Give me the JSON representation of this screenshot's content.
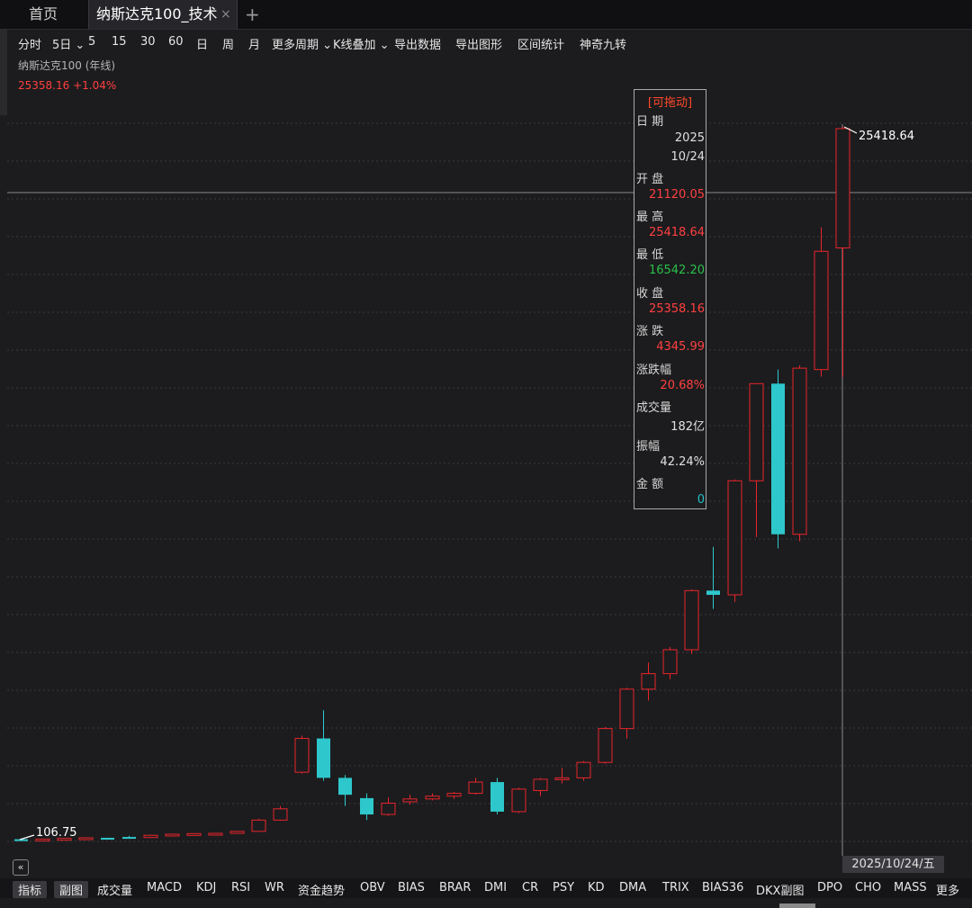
{
  "tabs": {
    "home": "首页",
    "active": "纳斯达克100_技术",
    "close": "×",
    "add": "+"
  },
  "toolbar": [
    "分时",
    "5日",
    "5",
    "15",
    "30",
    "60",
    "日",
    "周",
    "月",
    "更多周期",
    "K线叠加",
    "导出数据",
    "导出图形",
    "区间统计",
    "神奇九转"
  ],
  "chart_header": {
    "title": "纳斯达克100 (年线)",
    "price": "25358.16",
    "change": "+1.04%"
  },
  "colors": {
    "up": "#e8252b",
    "down": "#2ec8cc",
    "background": "#1c1c1e",
    "grid": "#3a3a3e"
  },
  "infobox": {
    "header": "[可拖动]",
    "date_label": "日 期",
    "date_year": "2025",
    "date_md": "10/24",
    "open_label": "开 盘",
    "open": "21120.05",
    "high_label": "最 高",
    "high": "25418.64",
    "low_label": "最 低",
    "low": "16542.20",
    "close_label": "收 盘",
    "close": "25358.16",
    "change_label": "涨 跌",
    "change": "4345.99",
    "pct_label": "涨跌幅",
    "pct": "20.68%",
    "volume_label": "成交量",
    "volume": "182亿",
    "amplitude_label": "振幅",
    "amplitude": "42.24%",
    "amount_label": "金 额",
    "amount": "0"
  },
  "annotations": {
    "max": "25418.64",
    "min": "106.75"
  },
  "cursor_date": "2025/10/24/五",
  "indicator_bar": {
    "index_btn": "指标",
    "sub_btn": "副图",
    "items": [
      "成交量",
      "MACD",
      "KDJ",
      "RSI",
      "WR",
      "资金趋势",
      "OBV",
      "BIAS",
      "BRAR",
      "DMI",
      "CR",
      "PSY",
      "KD",
      "DMA",
      "TRIX",
      "BIAS36",
      "DKX副图",
      "DPO",
      "CHO",
      "MASS",
      "更多"
    ]
  },
  "chart_data": {
    "type": "candlestick",
    "period": "yearly",
    "candles": [
      {
        "o": 120,
        "c": 110,
        "h": 130,
        "l": 106.75
      },
      {
        "o": 110,
        "c": 125,
        "h": 130,
        "l": 108
      },
      {
        "o": 125,
        "c": 150,
        "h": 160,
        "l": 120
      },
      {
        "o": 150,
        "c": 170,
        "h": 180,
        "l": 145
      },
      {
        "o": 170,
        "c": 165,
        "h": 175,
        "l": 160
      },
      {
        "o": 200,
        "c": 180,
        "h": 240,
        "l": 175
      },
      {
        "o": 180,
        "c": 260,
        "h": 270,
        "l": 175
      },
      {
        "o": 260,
        "c": 300,
        "h": 310,
        "l": 255
      },
      {
        "o": 300,
        "c": 320,
        "h": 330,
        "l": 295
      },
      {
        "o": 320,
        "c": 330,
        "h": 340,
        "l": 315
      },
      {
        "o": 330,
        "c": 400,
        "h": 420,
        "l": 325
      },
      {
        "o": 400,
        "c": 800,
        "h": 850,
        "l": 395
      },
      {
        "o": 800,
        "c": 1200,
        "h": 1300,
        "l": 780
      },
      {
        "o": 2500,
        "c": 3700,
        "h": 3800,
        "l": 2450
      },
      {
        "o": 3700,
        "c": 2300,
        "h": 4700,
        "l": 2200
      },
      {
        "o": 2300,
        "c": 1700,
        "h": 2400,
        "l": 1300
      },
      {
        "o": 1580,
        "c": 1000,
        "h": 1750,
        "l": 800
      },
      {
        "o": 1000,
        "c": 1400,
        "h": 1600,
        "l": 950
      },
      {
        "o": 1450,
        "c": 1550,
        "h": 1700,
        "l": 1350
      },
      {
        "o": 1550,
        "c": 1650,
        "h": 1750,
        "l": 1500
      },
      {
        "o": 1650,
        "c": 1750,
        "h": 1800,
        "l": 1550
      },
      {
        "o": 1750,
        "c": 2150,
        "h": 2300,
        "l": 1700
      },
      {
        "o": 2150,
        "c": 1100,
        "h": 2300,
        "l": 1000
      },
      {
        "o": 1100,
        "c": 1900,
        "h": 1950,
        "l": 1050
      },
      {
        "o": 1850,
        "c": 2250,
        "h": 2300,
        "l": 1650
      },
      {
        "o": 2250,
        "c": 2300,
        "h": 2650,
        "l": 2100
      },
      {
        "o": 2300,
        "c": 2850,
        "h": 2900,
        "l": 2200
      },
      {
        "o": 2850,
        "c": 4050,
        "h": 4100,
        "l": 2800
      },
      {
        "o": 4050,
        "c": 5450,
        "h": 5500,
        "l": 3700
      },
      {
        "o": 5450,
        "c": 6000,
        "h": 6400,
        "l": 5050
      },
      {
        "o": 6000,
        "c": 6850,
        "h": 6950,
        "l": 5800
      },
      {
        "o": 6850,
        "c": 8950,
        "h": 9000,
        "l": 6700
      },
      {
        "o": 8950,
        "c": 8800,
        "h": 10500,
        "l": 8300
      },
      {
        "o": 8800,
        "c": 12850,
        "h": 12900,
        "l": 8550
      },
      {
        "o": 12850,
        "c": 16300,
        "h": 16300,
        "l": 10850
      },
      {
        "o": 16300,
        "c": 10950,
        "h": 16800,
        "l": 10450
      },
      {
        "o": 10950,
        "c": 16850,
        "h": 16950,
        "l": 10700
      },
      {
        "o": 16800,
        "c": 21000,
        "h": 21850,
        "l": 16550
      },
      {
        "o": 21120.05,
        "c": 25358.16,
        "h": 25418.64,
        "l": 16542.2
      }
    ],
    "ylim": [
      106.75,
      25418.64
    ],
    "grid": "horizontal-dashed"
  }
}
